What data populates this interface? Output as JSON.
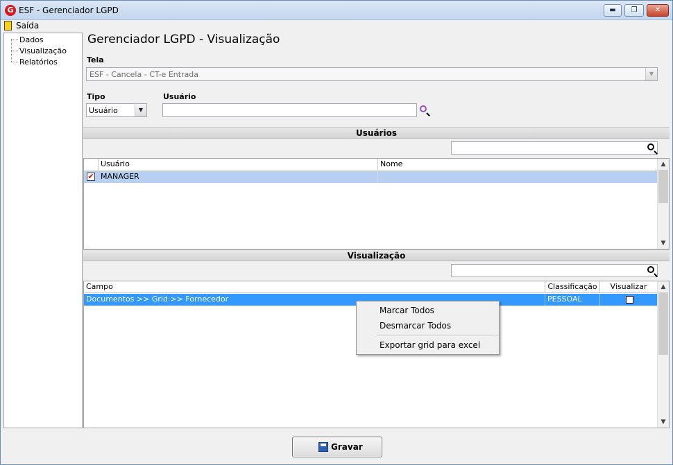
{
  "window": {
    "title": "ESF - Gerenciador LGPD",
    "logo": "G",
    "controls": {
      "minimize": "▬",
      "maximize": "❐",
      "close": "✕"
    }
  },
  "menu": {
    "exit": "Saída"
  },
  "tree": {
    "items": [
      "Dados",
      "Visualização",
      "Relatórios"
    ]
  },
  "page": {
    "title": "Gerenciador LGPD - Visualização"
  },
  "form": {
    "tela_label": "Tela",
    "tela_value": "ESF - Cancela - CT-e Entrada",
    "tipo_label": "Tipo",
    "tipo_value": "Usuário",
    "usuario_label": "Usuário",
    "usuario_value": ""
  },
  "users_section": {
    "header": "Usuários",
    "search_value": "",
    "columns": [
      "Usuário",
      "Nome"
    ],
    "rows": [
      {
        "checked": true,
        "usuario": "MANAGER",
        "nome": ""
      }
    ]
  },
  "view_section": {
    "header": "Visualização",
    "search_value": "",
    "columns": [
      "Campo",
      "Classificação",
      "Visualizar"
    ],
    "rows": [
      {
        "campo": "Documentos >> Grid >> Fornecedor",
        "classificacao": "PESSOAL",
        "visualizar": false
      }
    ]
  },
  "context_menu": {
    "items": [
      "Marcar Todos",
      "Desmarcar Todos",
      "Exportar grid para excel"
    ]
  },
  "footer": {
    "save_label": "Gravar"
  },
  "colors": {
    "selection": "#3399ff",
    "user_row_selected": "#b7cff0",
    "search_purple": "#9b4fb0",
    "title_bg": "#c2d6ee"
  }
}
